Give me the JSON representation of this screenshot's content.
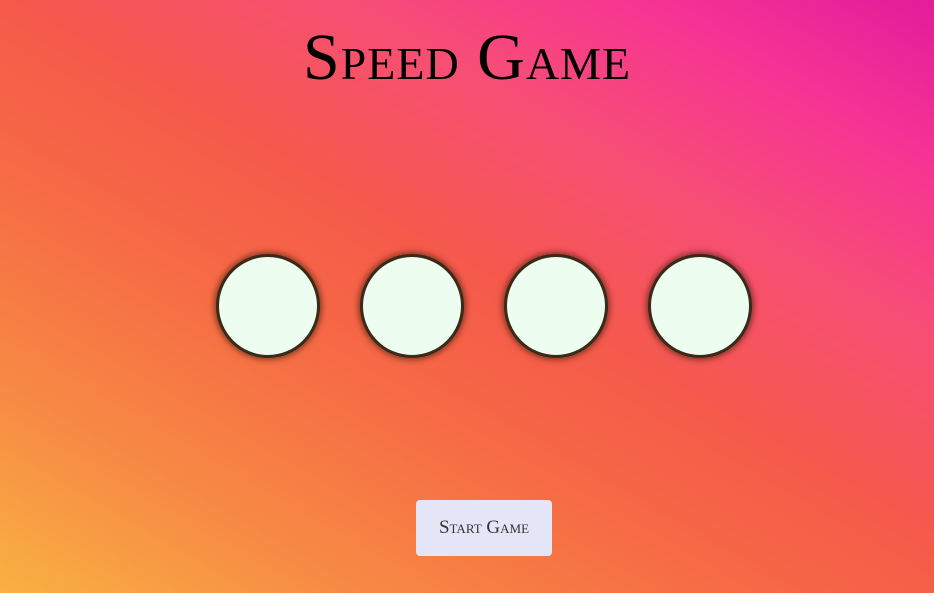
{
  "title": "Speed Game",
  "circles": [
    {
      "label": ""
    },
    {
      "label": ""
    },
    {
      "label": ""
    },
    {
      "label": ""
    }
  ],
  "start_button": {
    "label": "Start Game"
  },
  "colors": {
    "circle_fill": "#edfdef",
    "circle_border": "#3a2a1a",
    "button_bg": "#e4e6f8",
    "gradient_start": "#f8b142",
    "gradient_mid": "#f55a4a",
    "gradient_end": "#e11d9b"
  }
}
